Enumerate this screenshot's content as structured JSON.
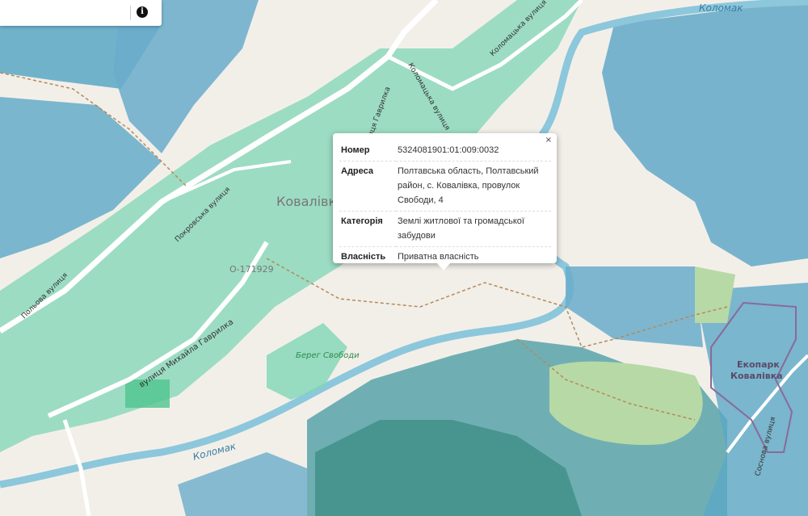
{
  "map": {
    "labels": {
      "kolomak_river_top": "Коломак",
      "kolomak_river_bottom": "Коломак",
      "village": "Ковалівка",
      "road_ref": "О-171929",
      "park_line1": "Берег Свободи",
      "ecopark_line1": "Екопарк",
      "ecopark_line2": "Ковалівка",
      "street_kolomatska_1": "Коломацька вулиця",
      "street_kolomatska_2": "Коломацька вулиця",
      "street_pokrovska": "Покровська вулиця",
      "street_polova": "Польова вулиця",
      "street_havrylka_1": "вулиця Михайла Гаврилка",
      "street_havrylka_2": "вулиця Гаврилка",
      "street_sosnova": "Соснова вулиця"
    },
    "colors": {
      "land": "#f2efe9",
      "water": "#6aaccb",
      "parcel_green": "#7fd6b5",
      "parcel_blue": "#5ba7c6",
      "road": "#ffffff",
      "ecopark_border": "#8a6a9a"
    }
  },
  "search": {
    "placeholder": "",
    "info_icon": "i"
  },
  "popup": {
    "close": "×",
    "rows": [
      {
        "key": "Номер",
        "value": "5324081901:01:009:0032"
      },
      {
        "key": "Адреса",
        "value": "Полтавська область, Полтавський район, с. Ковалівка, провулок Свободи, 4"
      },
      {
        "key": "Категорія",
        "value": "Землі житлової та громадської забудови"
      },
      {
        "key": "Власність",
        "value": "Приватна власність"
      }
    ]
  }
}
